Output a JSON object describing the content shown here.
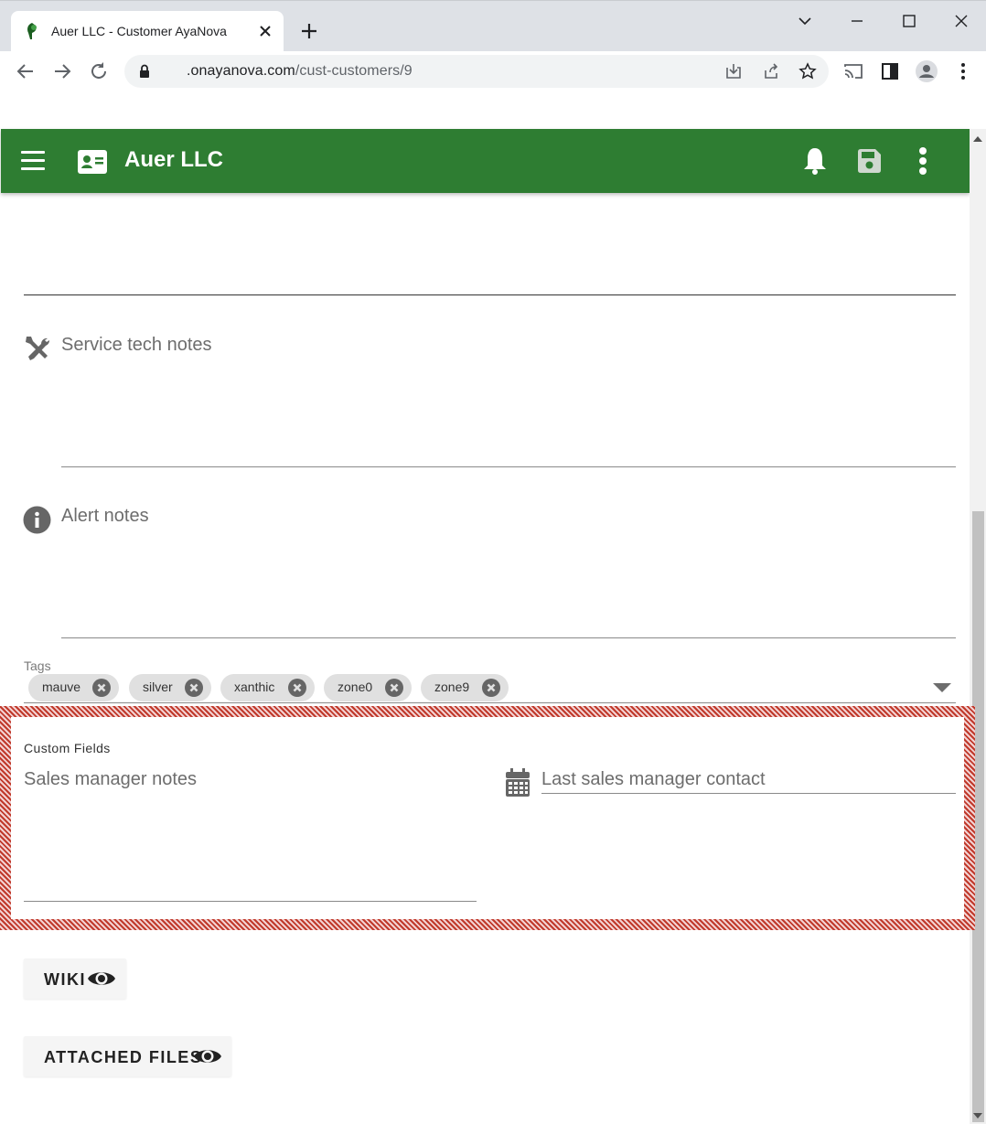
{
  "browser": {
    "tab_title": "Auer LLC - Customer AyaNova",
    "url_host": ".onayanova.com",
    "url_path": "/cust-customers/9"
  },
  "appbar": {
    "title": "Auer LLC",
    "color": "#2e7d32"
  },
  "form": {
    "service_tech_notes_label": "Service tech notes",
    "alert_notes_label": "Alert notes",
    "tags_label": "Tags",
    "tags": [
      "mauve",
      "silver",
      "xanthic",
      "zone0",
      "zone9"
    ]
  },
  "custom_fields": {
    "title": "Custom Fields",
    "sales_manager_notes_label": "Sales manager notes",
    "last_sales_manager_contact_label": "Last sales manager contact"
  },
  "buttons": {
    "wiki_label": "WIKI",
    "attached_files_label": "ATTACHED FILES"
  },
  "icons": {
    "menu": "hamburger-menu-icon",
    "customer": "contact-card-icon",
    "notifications": "bell-icon",
    "save": "floppy-disk-icon",
    "more": "kebab-menu-icon",
    "service_tech": "wrench-screwdriver-icon",
    "alert": "info-icon",
    "date": "calendar-icon",
    "view": "eye-icon"
  }
}
